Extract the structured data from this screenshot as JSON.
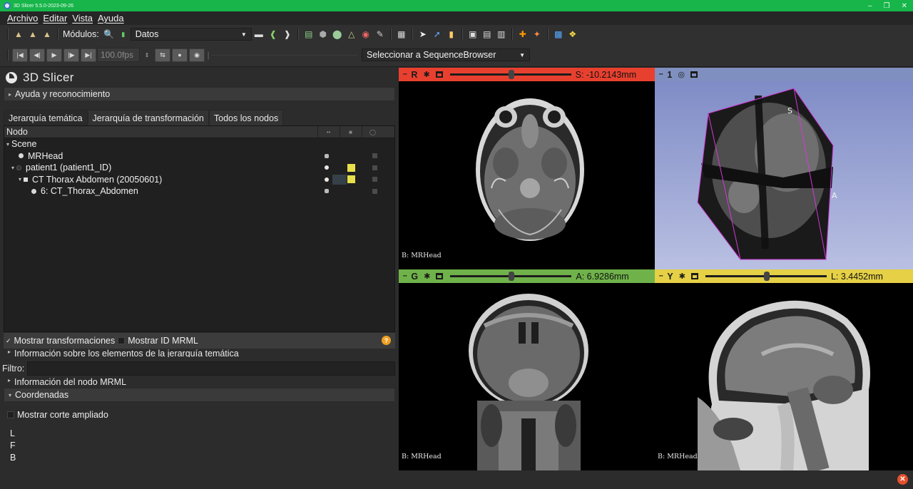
{
  "window": {
    "title": "3D Slicer 5.5.0-2023-09-26"
  },
  "menu": [
    "Archivo",
    "Editar",
    "Vista",
    "Ayuda"
  ],
  "toolbar": {
    "modules_label": "Módulos:",
    "module_selected": "Datos",
    "fps": "100.0fps",
    "sequence_selector": "Seleccionar a SequenceBrowser"
  },
  "panel": {
    "app_name": "3D Slicer",
    "help_section": "Ayuda y reconocimiento",
    "tabs": [
      "Jerarquía temática",
      "Jerarquía de transformación",
      "Todos los nodos"
    ],
    "tree_header": "Nodo",
    "tree_rows": [
      {
        "label": "Scene",
        "level": 0,
        "type": "scene"
      },
      {
        "label": "MRHead",
        "level": 1,
        "type": "volume"
      },
      {
        "label": "patient1 (patient1_ID)",
        "level": 1,
        "type": "patient"
      },
      {
        "label": "CT Thorax Abdomen (20050601)",
        "level": 2,
        "type": "study"
      },
      {
        "label": "6: CT_Thorax_Abdomen",
        "level": 3,
        "type": "volume"
      }
    ],
    "show_transforms": "Mostrar transformaciones",
    "show_mrml_id": "Mostrar ID MRML",
    "subject_info": "Información sobre los elementos de la jerarquía temática",
    "filter_label": "Filtro:",
    "mrml_info": "Información del nodo MRML",
    "coords_section": "Coordenadas",
    "show_zoomed": "Mostrar corte ampliado",
    "coord_labels": [
      "L",
      "F",
      "B"
    ]
  },
  "views": {
    "red": {
      "label": "R",
      "offset": "S: -10.2143mm",
      "color": "#e8402f",
      "volume": "B: MRHead"
    },
    "threed": {
      "label": "1",
      "color": "#7f8fbf"
    },
    "green": {
      "label": "G",
      "offset": "A: 6.9286mm",
      "color": "#6fb24a",
      "volume": "B: MRHead"
    },
    "yellow": {
      "label": "Y",
      "offset": "L: 3.4452mm",
      "color": "#e5d046",
      "volume": "B: MRHead"
    },
    "threed_orient": {
      "s": "S",
      "a": "A"
    }
  }
}
